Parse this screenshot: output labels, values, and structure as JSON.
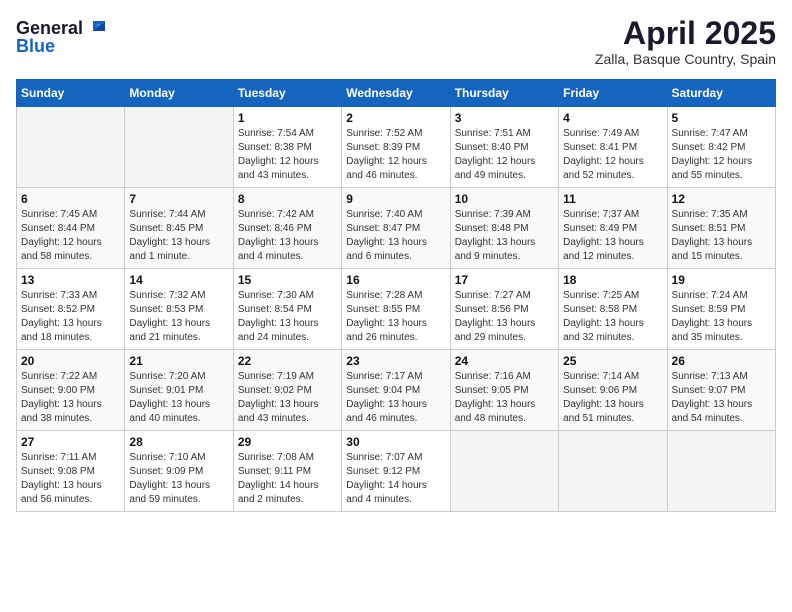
{
  "logo": {
    "general": "General",
    "blue": "Blue"
  },
  "header": {
    "month": "April 2025",
    "location": "Zalla, Basque Country, Spain"
  },
  "weekdays": [
    "Sunday",
    "Monday",
    "Tuesday",
    "Wednesday",
    "Thursday",
    "Friday",
    "Saturday"
  ],
  "weeks": [
    [
      {
        "day": "",
        "info": ""
      },
      {
        "day": "",
        "info": ""
      },
      {
        "day": "1",
        "info": "Sunrise: 7:54 AM\nSunset: 8:38 PM\nDaylight: 12 hours and 43 minutes."
      },
      {
        "day": "2",
        "info": "Sunrise: 7:52 AM\nSunset: 8:39 PM\nDaylight: 12 hours and 46 minutes."
      },
      {
        "day": "3",
        "info": "Sunrise: 7:51 AM\nSunset: 8:40 PM\nDaylight: 12 hours and 49 minutes."
      },
      {
        "day": "4",
        "info": "Sunrise: 7:49 AM\nSunset: 8:41 PM\nDaylight: 12 hours and 52 minutes."
      },
      {
        "day": "5",
        "info": "Sunrise: 7:47 AM\nSunset: 8:42 PM\nDaylight: 12 hours and 55 minutes."
      }
    ],
    [
      {
        "day": "6",
        "info": "Sunrise: 7:45 AM\nSunset: 8:44 PM\nDaylight: 12 hours and 58 minutes."
      },
      {
        "day": "7",
        "info": "Sunrise: 7:44 AM\nSunset: 8:45 PM\nDaylight: 13 hours and 1 minute."
      },
      {
        "day": "8",
        "info": "Sunrise: 7:42 AM\nSunset: 8:46 PM\nDaylight: 13 hours and 4 minutes."
      },
      {
        "day": "9",
        "info": "Sunrise: 7:40 AM\nSunset: 8:47 PM\nDaylight: 13 hours and 6 minutes."
      },
      {
        "day": "10",
        "info": "Sunrise: 7:39 AM\nSunset: 8:48 PM\nDaylight: 13 hours and 9 minutes."
      },
      {
        "day": "11",
        "info": "Sunrise: 7:37 AM\nSunset: 8:49 PM\nDaylight: 13 hours and 12 minutes."
      },
      {
        "day": "12",
        "info": "Sunrise: 7:35 AM\nSunset: 8:51 PM\nDaylight: 13 hours and 15 minutes."
      }
    ],
    [
      {
        "day": "13",
        "info": "Sunrise: 7:33 AM\nSunset: 8:52 PM\nDaylight: 13 hours and 18 minutes."
      },
      {
        "day": "14",
        "info": "Sunrise: 7:32 AM\nSunset: 8:53 PM\nDaylight: 13 hours and 21 minutes."
      },
      {
        "day": "15",
        "info": "Sunrise: 7:30 AM\nSunset: 8:54 PM\nDaylight: 13 hours and 24 minutes."
      },
      {
        "day": "16",
        "info": "Sunrise: 7:28 AM\nSunset: 8:55 PM\nDaylight: 13 hours and 26 minutes."
      },
      {
        "day": "17",
        "info": "Sunrise: 7:27 AM\nSunset: 8:56 PM\nDaylight: 13 hours and 29 minutes."
      },
      {
        "day": "18",
        "info": "Sunrise: 7:25 AM\nSunset: 8:58 PM\nDaylight: 13 hours and 32 minutes."
      },
      {
        "day": "19",
        "info": "Sunrise: 7:24 AM\nSunset: 8:59 PM\nDaylight: 13 hours and 35 minutes."
      }
    ],
    [
      {
        "day": "20",
        "info": "Sunrise: 7:22 AM\nSunset: 9:00 PM\nDaylight: 13 hours and 38 minutes."
      },
      {
        "day": "21",
        "info": "Sunrise: 7:20 AM\nSunset: 9:01 PM\nDaylight: 13 hours and 40 minutes."
      },
      {
        "day": "22",
        "info": "Sunrise: 7:19 AM\nSunset: 9:02 PM\nDaylight: 13 hours and 43 minutes."
      },
      {
        "day": "23",
        "info": "Sunrise: 7:17 AM\nSunset: 9:04 PM\nDaylight: 13 hours and 46 minutes."
      },
      {
        "day": "24",
        "info": "Sunrise: 7:16 AM\nSunset: 9:05 PM\nDaylight: 13 hours and 48 minutes."
      },
      {
        "day": "25",
        "info": "Sunrise: 7:14 AM\nSunset: 9:06 PM\nDaylight: 13 hours and 51 minutes."
      },
      {
        "day": "26",
        "info": "Sunrise: 7:13 AM\nSunset: 9:07 PM\nDaylight: 13 hours and 54 minutes."
      }
    ],
    [
      {
        "day": "27",
        "info": "Sunrise: 7:11 AM\nSunset: 9:08 PM\nDaylight: 13 hours and 56 minutes."
      },
      {
        "day": "28",
        "info": "Sunrise: 7:10 AM\nSunset: 9:09 PM\nDaylight: 13 hours and 59 minutes."
      },
      {
        "day": "29",
        "info": "Sunrise: 7:08 AM\nSunset: 9:11 PM\nDaylight: 14 hours and 2 minutes."
      },
      {
        "day": "30",
        "info": "Sunrise: 7:07 AM\nSunset: 9:12 PM\nDaylight: 14 hours and 4 minutes."
      },
      {
        "day": "",
        "info": ""
      },
      {
        "day": "",
        "info": ""
      },
      {
        "day": "",
        "info": ""
      }
    ]
  ]
}
